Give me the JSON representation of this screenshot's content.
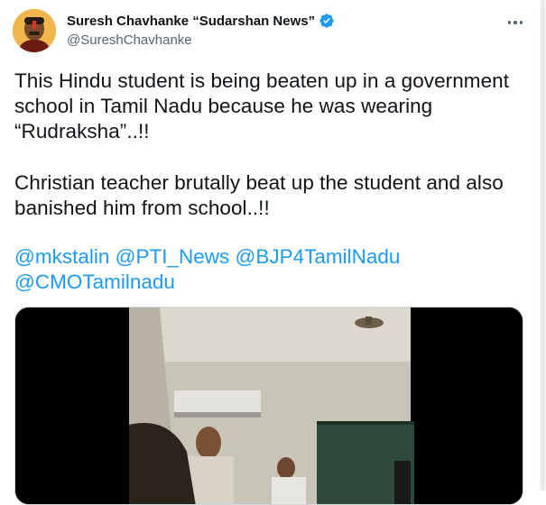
{
  "tweet": {
    "author": {
      "display_name": "Suresh Chavhanke “Sudarshan News”",
      "handle": "@SureshChavhanke",
      "verified": true,
      "avatar_icon": "profile-photo",
      "verified_icon": "verified-badge-icon"
    },
    "more_icon": "more-options-icon",
    "body": {
      "paragraph_1_line_1": "This Hindu student is being beaten up in a government",
      "paragraph_1_line_2": "school in Tamil Nadu because he was wearing",
      "paragraph_1_line_3": "“Rudraksha”..!!",
      "paragraph_2_line_1": "Christian teacher brutally beat up the student and also",
      "paragraph_2_line_2": "banished him from school..!!"
    },
    "mentions": [
      "@mkstalin",
      "@PTI_News",
      "@BJP4TamilNadu",
      "@CMOTamilnadu"
    ],
    "media": {
      "type": "video",
      "description_icon": "classroom-video-thumbnail"
    }
  },
  "colors": {
    "text": "#0f1419",
    "secondary": "#536471",
    "link": "#1d9bf0",
    "verified": "#1d9bf0"
  }
}
